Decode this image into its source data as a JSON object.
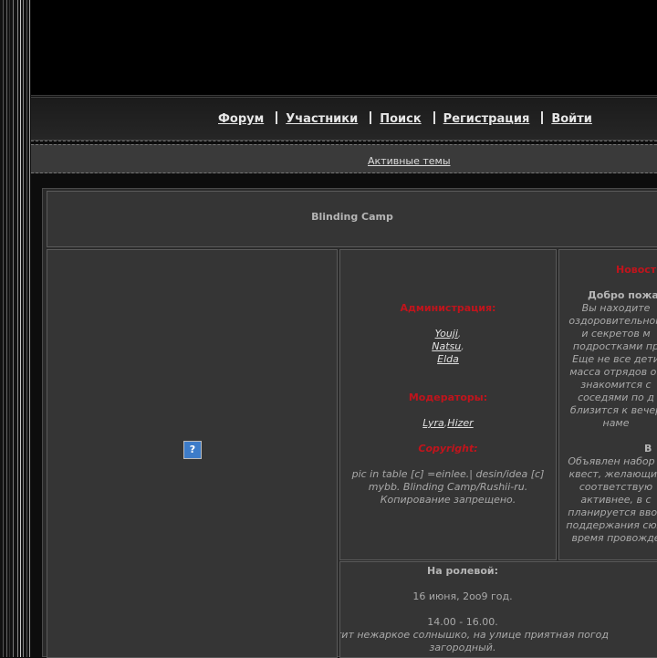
{
  "nav": {
    "items": [
      "Форум",
      "Участники",
      "Поиск",
      "Регистрация",
      "Войти"
    ]
  },
  "active_topics": "Активные темы",
  "forum_title": "Blinding Camp",
  "admin": {
    "heading": "Администрация:",
    "members": [
      "Youji",
      "Natsu",
      "Elda"
    ]
  },
  "moderators": {
    "heading": "Модераторы:",
    "members": [
      "Lyra",
      "Hizer"
    ]
  },
  "copyright": {
    "heading": "Copyright:",
    "lines": [
      "pic in table [c] =einlee.| desin/idea [c]",
      "mybb. Blinding Camp/Rushii-ru.",
      "Копирование запрещено."
    ]
  },
  "news": {
    "heading_visible": "Новост",
    "welcome_visible": "Добро пожа",
    "text_lines": [
      "Вы находите",
      "оздоровительном",
      "и секретов м",
      "подростками пр",
      "Еще не все дети",
      "масса отрядов от",
      "знакомится с",
      "соседями по д",
      "близится к вечер",
      "наме"
    ],
    "sub_heading_visible": "В",
    "sub_lines": [
      "Объявлен набор у",
      "квест, желающих",
      "соответствую",
      "активнее, в с",
      "планируется ввод",
      "поддержания сюж",
      "время провожде"
    ]
  },
  "roleplay": {
    "heading": "На ролевой:",
    "date": "16 июня, 2oo9 год.",
    "time": "14.00 - 16.00.",
    "line1": "Светит нежаркое солнышко, на улице приятная погод",
    "line2": "загородный."
  },
  "colors": {
    "accent_red": "#c0141c",
    "background": "#0d0d0d",
    "panel": "#353535"
  },
  "icons": {
    "broken_image": "broken-image-icon"
  }
}
